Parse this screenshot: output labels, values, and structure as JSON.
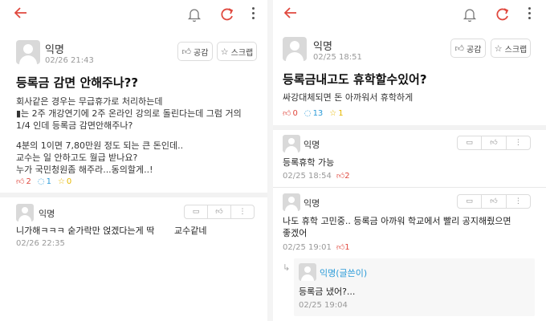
{
  "left": {
    "post": {
      "author": "익명",
      "time": "02/26 21:43",
      "empathy_label": "공감",
      "scrap_label": "스크랩",
      "title": "등록금 감면 안해주나??",
      "body_lines": [
        "회사같은 경우는 무급휴가로 처리하는데",
        "▮는 2주 개강연기에 2주 온라인 강의로 돌린다는데 그럼 거의",
        "1/4 인데 등록금 감면안해주나?",
        "",
        "4분의 1이면 7,80만원 정도 되는 큰 돈인데..",
        "교수는 일 안하고도 월급 받나요?",
        "누가 국민청원좀 해주라...동의할게..!"
      ],
      "likes": "2",
      "comments": "1",
      "scraps": "0"
    },
    "comment": {
      "author": "익명",
      "text_part1": "니가해ㅋㅋㅋ 숟가락만 얹겠다는게 딱",
      "text_part2": "교수같네",
      "time": "02/26 22:35"
    }
  },
  "right": {
    "post": {
      "author": "익명",
      "time": "02/25 18:51",
      "empathy_label": "공감",
      "scrap_label": "스크랩",
      "title": "등록금내고도 휴학할수있어?",
      "body_lines": [
        "싸강대체되면 돈 아까워서 휴학하게"
      ],
      "likes": "0",
      "comments": "13",
      "scraps": "1"
    },
    "comments": [
      {
        "author": "익명",
        "lines": [
          "등록휴학 가능"
        ],
        "time": "02/25 18:54",
        "likes": "2"
      },
      {
        "author": "익명",
        "lines": [
          "나도 휴학 고민중.. 등록금 아까워 학교에서 빨리 공지해줬으면",
          "좋겠어"
        ],
        "time": "02/25 19:01",
        "likes": "1"
      }
    ],
    "reply": {
      "author": "익명(글쓴이)",
      "text": "등록금 냈어?...",
      "time": "02/25 19:04"
    }
  },
  "icons": {
    "back": "back-arrow-icon",
    "bell": "bell-off-icon",
    "refresh": "refresh-icon",
    "more": "more-vertical-icon"
  },
  "colors": {
    "accent": "#e0483e",
    "comment_blue": "#2b9bd8",
    "scrap_yellow": "#e6b800",
    "meta_gray": "#999999"
  }
}
